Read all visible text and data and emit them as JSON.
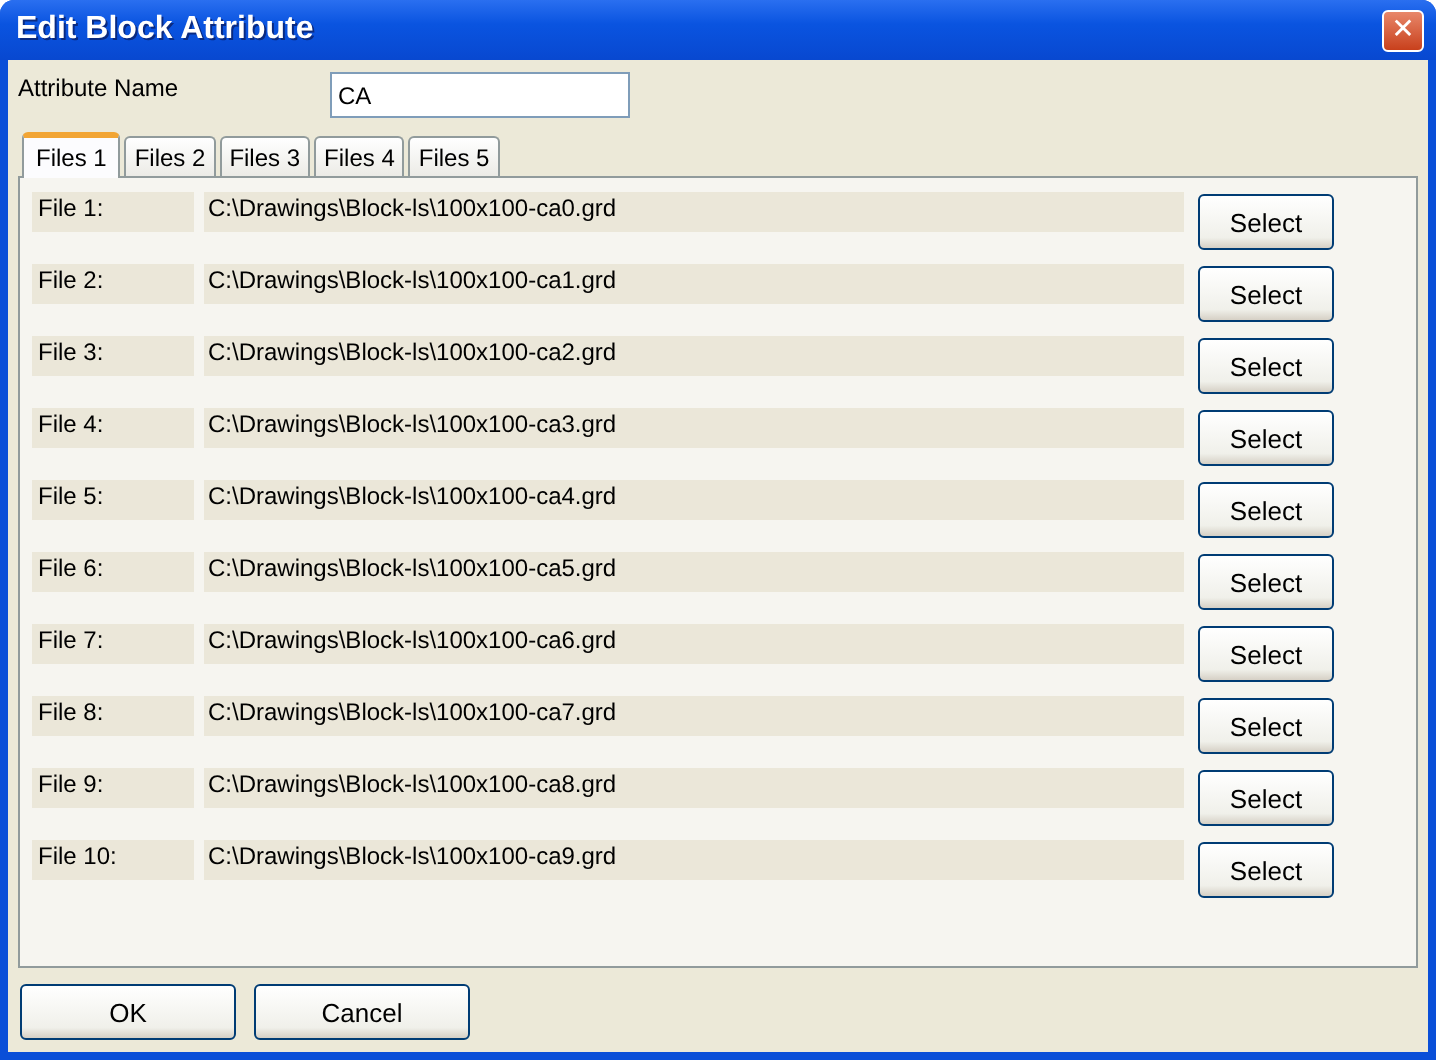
{
  "window": {
    "title": "Edit Block Attribute",
    "close": "✕"
  },
  "attribute_name": {
    "label": "Attribute Name",
    "value": "CA"
  },
  "tabs": [
    {
      "label": "Files 1",
      "selected": true
    },
    {
      "label": "Files 2",
      "selected": false
    },
    {
      "label": "Files 3",
      "selected": false
    },
    {
      "label": "Files 4",
      "selected": false
    },
    {
      "label": "Files 5",
      "selected": false
    }
  ],
  "files": [
    {
      "label": "File 1:",
      "path": "C:\\Drawings\\Block-ls\\100x100-ca0.grd",
      "button": "Select"
    },
    {
      "label": "File 2:",
      "path": "C:\\Drawings\\Block-ls\\100x100-ca1.grd",
      "button": "Select"
    },
    {
      "label": "File 3:",
      "path": "C:\\Drawings\\Block-ls\\100x100-ca2.grd",
      "button": "Select"
    },
    {
      "label": "File 4:",
      "path": "C:\\Drawings\\Block-ls\\100x100-ca3.grd",
      "button": "Select"
    },
    {
      "label": "File 5:",
      "path": "C:\\Drawings\\Block-ls\\100x100-ca4.grd",
      "button": "Select"
    },
    {
      "label": "File 6:",
      "path": "C:\\Drawings\\Block-ls\\100x100-ca5.grd",
      "button": "Select"
    },
    {
      "label": "File 7:",
      "path": "C:\\Drawings\\Block-ls\\100x100-ca6.grd",
      "button": "Select"
    },
    {
      "label": "File 8:",
      "path": "C:\\Drawings\\Block-ls\\100x100-ca7.grd",
      "button": "Select"
    },
    {
      "label": "File 9:",
      "path": "C:\\Drawings\\Block-ls\\100x100-ca8.grd",
      "button": "Select"
    },
    {
      "label": "File 10:",
      "path": "C:\\Drawings\\Block-ls\\100x100-ca9.grd",
      "button": "Select"
    }
  ],
  "buttons": [
    "OK",
    "Cancel"
  ]
}
